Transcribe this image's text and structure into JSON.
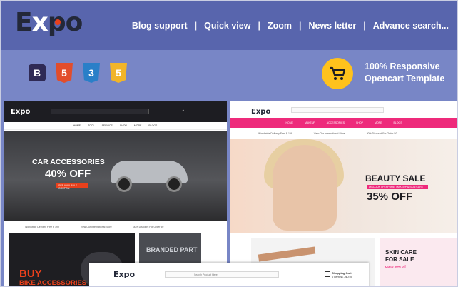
{
  "brand": {
    "logo_e": "E",
    "logo_x": "x",
    "logo_po": "po"
  },
  "header": {
    "nav": [
      "Blog support",
      "Quick view",
      "Zoom",
      "News letter",
      "Advance search..."
    ],
    "separator": "|"
  },
  "tech_badges": [
    {
      "name": "bootstrap-icon",
      "glyph": "B"
    },
    {
      "name": "html5-icon",
      "glyph": "5"
    },
    {
      "name": "css3-icon",
      "glyph": "3"
    },
    {
      "name": "javascript-icon",
      "glyph": "5"
    }
  ],
  "promo": {
    "line1": "100% Responsive",
    "line2": "Opencart Template"
  },
  "panel_left": {
    "logo": "Expo",
    "menu": [
      "HOME",
      "TOOL",
      "SERVICE",
      "SHOP",
      "MORE",
      "BLOGS"
    ],
    "hero_line1": "CAR ACCESSORIES",
    "hero_line2": "40% OFF",
    "hero_button": "SEE AVAILABLE COUPON",
    "strip": [
      "Worldwide Delivery Free $ 199",
      "View Our International Store",
      "30% Discount For Order 50"
    ],
    "tile1_line1": "BUY",
    "tile1_line2": "BIKE ACCESSORIES",
    "tile2_line1": "BRANDED PART"
  },
  "panel_right": {
    "logo": "Expo",
    "menu": [
      "HOME",
      "MAKEUP",
      "ACCESSORIES",
      "SHOP",
      "MORE",
      "BLOGS"
    ],
    "strip": [
      "Worldwide Delivery Free $ 199",
      "View Our International Store",
      "30% Discount For Order 50"
    ],
    "hero_line1": "BEAUTY SALE",
    "hero_tag": "DISCOUNT PERFUME, MAKEUP & SKIN CARE",
    "hero_line2": "35% OFF",
    "tile_skin_line1": "SKIN CARE",
    "tile_skin_line2": "FOR SALE",
    "tile_skin_line3": "Up to 20% off"
  },
  "panel_bottom": {
    "logo": "Expo",
    "search_placeholder": "Search Product Here",
    "cart_label": "Shopping Cart",
    "cart_value": "0 item(s) - $0.00"
  },
  "colors": {
    "header_bg": "#5865ad",
    "band_bg": "#7886c6",
    "accent_orange": "#e8401c",
    "accent_pink": "#ee2a7b",
    "accent_yellow": "#ffc21c"
  }
}
